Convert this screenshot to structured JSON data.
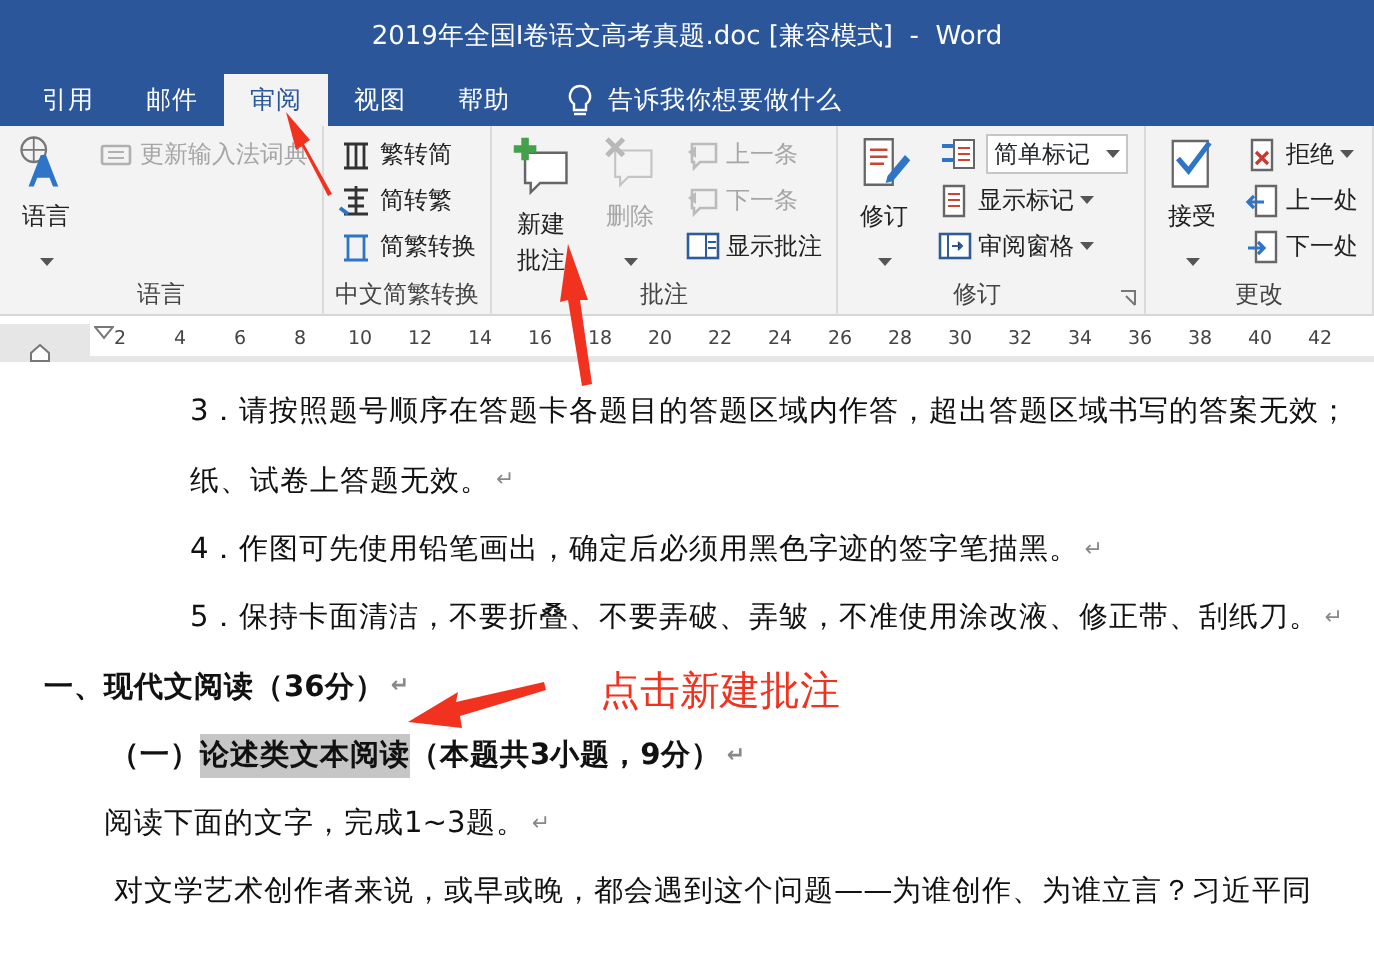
{
  "window": {
    "title": "2019年全国I卷语文高考真题.doc [兼容模式]  -  Word"
  },
  "tabs": [
    {
      "label": "引用",
      "selected": false
    },
    {
      "label": "邮件",
      "selected": false
    },
    {
      "label": "审阅",
      "selected": true
    },
    {
      "label": "视图",
      "selected": false
    },
    {
      "label": "帮助",
      "selected": false
    }
  ],
  "tell_me": {
    "label": "告诉我你想要做什么"
  },
  "ribbon": {
    "groups": [
      {
        "label": "语言",
        "items": [
          {
            "kind": "large",
            "label": "语言",
            "dropdown": true,
            "disabled": false
          },
          {
            "kind": "small",
            "label": "更新输入法词典",
            "disabled": true
          }
        ]
      },
      {
        "label": "中文简繁转换",
        "items": [
          {
            "kind": "small",
            "label": "繁转简",
            "disabled": false
          },
          {
            "kind": "small",
            "label": "简转繁",
            "disabled": false
          },
          {
            "kind": "small",
            "label": "简繁转换",
            "disabled": false
          }
        ]
      },
      {
        "label": "批注",
        "items": [
          {
            "kind": "large",
            "label": "新建批注",
            "disabled": false
          },
          {
            "kind": "large",
            "label": "删除",
            "dropdown": true,
            "disabled": true
          },
          {
            "kind": "small",
            "label": "上一条",
            "disabled": true
          },
          {
            "kind": "small",
            "label": "下一条",
            "disabled": true
          },
          {
            "kind": "small",
            "label": "显示批注",
            "disabled": false
          }
        ]
      },
      {
        "label": "修订",
        "launcher": true,
        "items": [
          {
            "kind": "large",
            "label": "修订",
            "dropdown": true,
            "disabled": false
          },
          {
            "kind": "combo",
            "label": "简单标记",
            "dropdown": true,
            "disabled": false
          },
          {
            "kind": "small",
            "label": "显示标记",
            "dropdown": true,
            "disabled": false
          },
          {
            "kind": "small",
            "label": "审阅窗格",
            "dropdown": true,
            "disabled": false
          }
        ]
      },
      {
        "label": "更改",
        "items": [
          {
            "kind": "large",
            "label": "接受",
            "dropdown": true,
            "disabled": false
          },
          {
            "kind": "small",
            "label": "拒绝",
            "dropdown": true,
            "disabled": false
          },
          {
            "kind": "small",
            "label": "上一处",
            "disabled": false
          },
          {
            "kind": "small",
            "label": "下一处",
            "disabled": false
          }
        ]
      }
    ]
  },
  "ruler": {
    "numbers": [
      "2",
      "4",
      "6",
      "8",
      "10",
      "12",
      "14",
      "16",
      "18",
      "20",
      "22",
      "24",
      "26",
      "28",
      "30",
      "32",
      "34",
      "36",
      "38",
      "40",
      "42"
    ]
  },
  "document": {
    "paragraphs": [
      {
        "kind": "item",
        "text": "3．请按照题号顺序在答题卡各题目的答题区域内作答，超出答题区域书写的答案无效；"
      },
      {
        "kind": "continuation",
        "text": "纸、试卷上答题无效。",
        "mark": "↵"
      },
      {
        "kind": "item",
        "text": "4．作图可先使用铅笔画出，确定后必须用黑色字迹的签字笔描黑。",
        "mark": "↵"
      },
      {
        "kind": "item",
        "text": "5．保持卡面清洁，不要折叠、不要弄破、弄皱，不准使用涂改液、修正带、刮纸刀。",
        "mark": "↵"
      },
      {
        "kind": "heading1",
        "text": "一、现代文阅读（36分）",
        "mark": "↵"
      },
      {
        "kind": "heading2",
        "runs": [
          {
            "text": "（一）",
            "highlighted": false
          },
          {
            "text": "论述类文本阅读",
            "highlighted": true
          },
          {
            "text": "（本题共3小题，9分）",
            "highlighted": false
          }
        ],
        "mark": "↵"
      },
      {
        "kind": "body",
        "text": "阅读下面的文字，完成1~3题。",
        "mark": "↵"
      },
      {
        "kind": "quote",
        "text": "对文学艺术创作者来说，或早或晚，都会遇到这个问题——为谁创作、为谁立言？习近平同"
      }
    ]
  },
  "annotations": {
    "note": "点击新建批注"
  }
}
